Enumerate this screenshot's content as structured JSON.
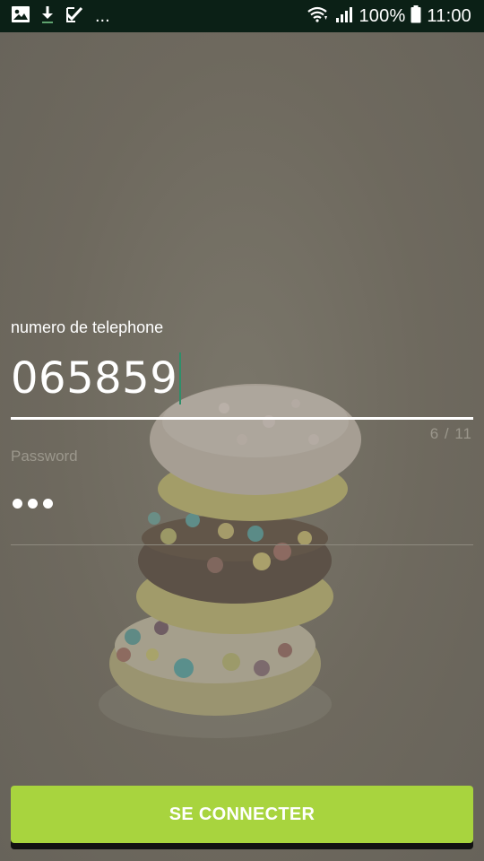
{
  "status_bar": {
    "left_icons": [
      "image-icon",
      "download-icon",
      "check-task-icon"
    ],
    "overflow": "...",
    "battery": "100%",
    "time": "11:00"
  },
  "background": {
    "description_icon": "stacked-macarons-photo-icon"
  },
  "form": {
    "phone_label": "numero de telephone",
    "phone_value": "065859",
    "phone_counter": "6 / 11",
    "password_label": "Password",
    "password_mask_count": 3
  },
  "submit": {
    "label": "SE CONNECTER"
  },
  "colors": {
    "status_bar_bg": "#0b2016",
    "overlay_bg": "#706b60",
    "accent_caret": "#2f8f6a",
    "button_bg": "#a8d43e",
    "hint_text": "#9b978c"
  }
}
